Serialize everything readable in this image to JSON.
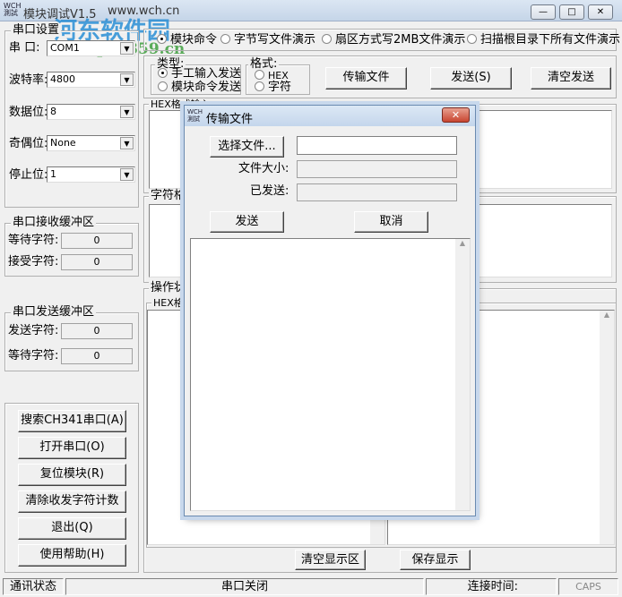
{
  "window": {
    "title": "模块调试V1.5",
    "url": "www.wch.cn",
    "min": "—",
    "max": "□",
    "close": "✕"
  },
  "watermark": {
    "name": "河东软件园",
    "url": "www.pc0359.cn"
  },
  "serial": {
    "group": "串口设置",
    "port_label": "串 口:",
    "port": "COM1",
    "baud_label": "波特率:",
    "baud": "4800",
    "data_label": "数据位:",
    "data": "8",
    "parity_label": "奇偶位:",
    "parity": "None",
    "stop_label": "停止位:",
    "stop": "1"
  },
  "recv": {
    "group": "串口接收缓冲区",
    "wait_label": "等待字符:",
    "wait": "0",
    "accept_label": "接受字符:",
    "accept": "0"
  },
  "send": {
    "group": "串口发送缓冲区",
    "sent_label": "发送字符:",
    "sent": "0",
    "wait_label": "等待字符:",
    "wait": "0"
  },
  "left_buttons": [
    "搜索CH341串口(A)",
    "打开串口(O)",
    "复位模块(R)",
    "清除收发字符计数",
    "退出(Q)",
    "使用帮助(H)"
  ],
  "modes": [
    {
      "label": "模块命令",
      "selected": true
    },
    {
      "label": "字节写文件演示",
      "selected": false
    },
    {
      "label": "扇区方式写2MB文件演示",
      "selected": false
    },
    {
      "label": "扫描根目录下所有文件演示",
      "selected": false
    }
  ],
  "type": {
    "group": "类型:",
    "options": [
      {
        "label": "手工输入发送",
        "selected": true
      },
      {
        "label": "模块命令发送",
        "selected": false
      }
    ]
  },
  "format": {
    "group": "格式:",
    "options": [
      {
        "label": "HEX",
        "selected": false
      },
      {
        "label": "字符",
        "selected": false
      }
    ]
  },
  "toolbar": {
    "transfer": "传输文件",
    "send": "发送(S)",
    "clear_send": "清空发送"
  },
  "hex_input": {
    "group": "HEX格式输入"
  },
  "char_input": {
    "group": "字符格式输入"
  },
  "status_group": {
    "group": "操作状态",
    "hex_sub": "HEX格式"
  },
  "bottom": {
    "clear_display": "清空显示区",
    "save_display": "保存显示"
  },
  "statusbar": {
    "comm": "通讯状态",
    "port_state": "串口关闭",
    "conn_time": "连接时间:",
    "caps": "CAPS"
  },
  "dialog": {
    "title": "传输文件",
    "select_file": "选择文件...",
    "file_path": "",
    "size_label": "文件大小:",
    "size": "",
    "sent_label": "已发送:",
    "sent": "",
    "send": "发送",
    "cancel": "取消",
    "close": "✕"
  }
}
